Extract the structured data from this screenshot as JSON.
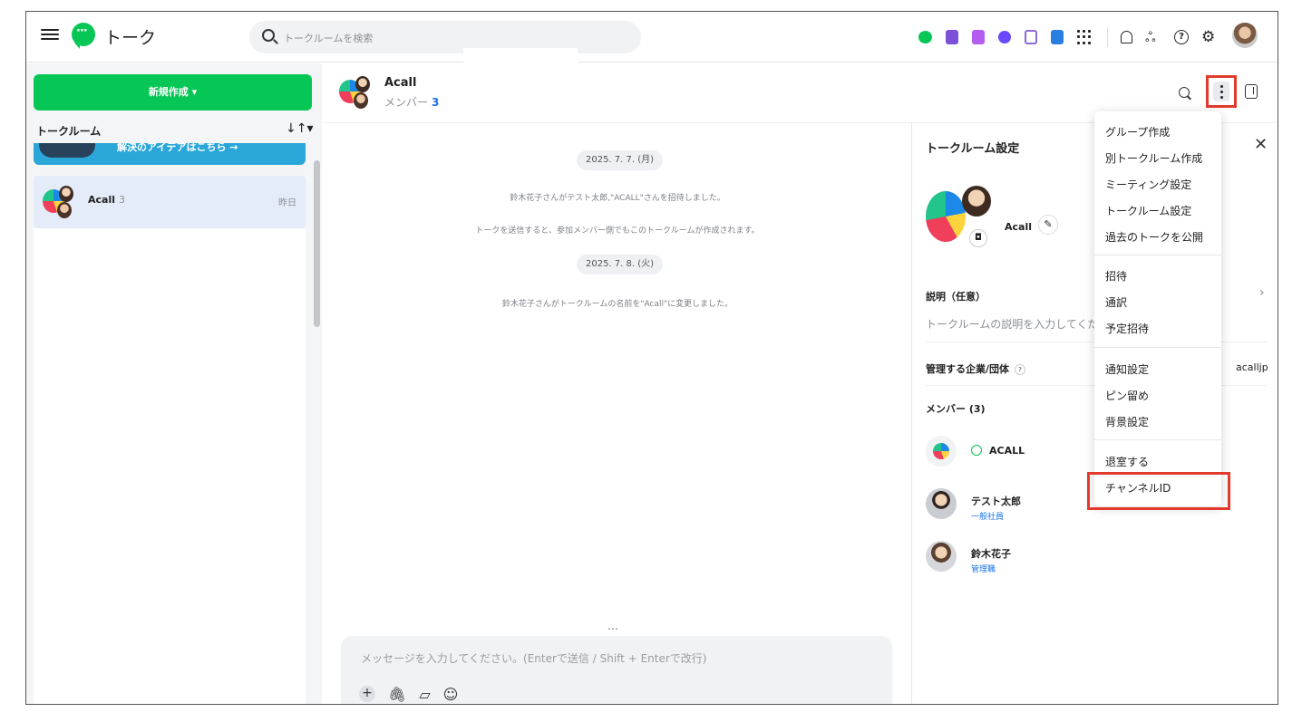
{
  "topbar": {
    "app_title": "トーク",
    "search_placeholder": "トークルームを検索",
    "app_icons": [
      "talk-icon",
      "calendar-icon",
      "note-icon",
      "task-icon",
      "form-icon",
      "addressbook-icon",
      "apps-grid-icon"
    ],
    "utility_icons": [
      "bell-icon",
      "organization-icon",
      "help-icon",
      "gear-icon",
      "user-avatar"
    ]
  },
  "sidebar": {
    "new_button": "新規作成 ▾",
    "section_title": "トークルーム",
    "sort_icon": "↓↑▾",
    "banner_text": "解決のアイデアはこちら →",
    "rooms": [
      {
        "name": "Acall",
        "count": "3",
        "time": "昨日"
      }
    ]
  },
  "chat": {
    "title": "Acall",
    "members_label": "メンバー",
    "members_count": "3",
    "messages": [
      {
        "type": "date",
        "text": "2025. 7. 7. (月)"
      },
      {
        "type": "system",
        "text": "鈴木花子さんがテスト太郎,\"ACALL\"さんを招待しました。"
      },
      {
        "type": "system",
        "text": "トークを送信すると、参加メンバー側でもこのトークルームが作成されます。"
      },
      {
        "type": "date",
        "text": "2025. 7. 8. (火)"
      },
      {
        "type": "system",
        "text": "鈴木花子さんがトークルームの名前を\"Acall\"に変更しました。"
      }
    ],
    "typing_indicator": "…",
    "composer_placeholder": "メッセージを入力してください。(Enterで送信 / Shift + Enterで改行)",
    "composer_icons": [
      "plus-icon",
      "attach-icon",
      "sticker-icon",
      "emoji-icon"
    ]
  },
  "settings": {
    "title": "トークルーム設定",
    "room_name": "Acall",
    "description_label": "説明（任意）",
    "description_placeholder": "トークルームの説明を入力してください",
    "org_label": "管理する企業/団体",
    "org_help": "?",
    "org_value": "acalljp",
    "members_label": "メンバー (3)",
    "members": [
      {
        "name": "ACALL",
        "role": ""
      },
      {
        "name": "テスト太郎",
        "role": "一般社員"
      },
      {
        "name": "鈴木花子",
        "role": "管理職"
      }
    ]
  },
  "menu": {
    "items": [
      "グループ作成",
      "別トークルーム作成",
      "ミーティング設定",
      "トークルーム設定",
      "過去のトークを公開",
      "招待",
      "通訳",
      "予定招待",
      "通知設定",
      "ピン留め",
      "背景設定",
      "退室する",
      "チャンネルID"
    ]
  },
  "colors": {
    "accent_green": "#06c755",
    "highlight_red": "#e23b2e",
    "link_blue": "#1a73e8"
  }
}
